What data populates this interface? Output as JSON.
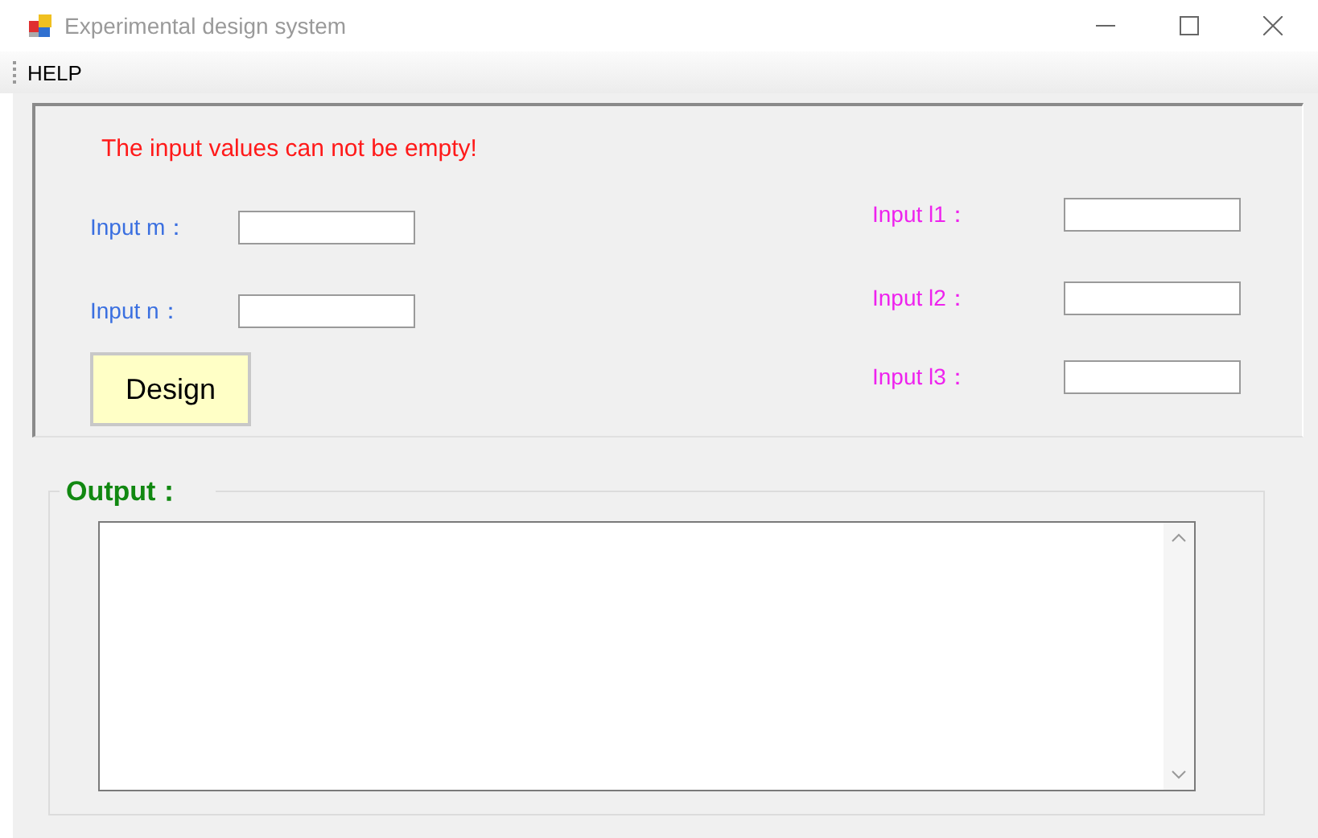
{
  "window": {
    "title": "Experimental design system"
  },
  "menu": [
    {
      "label": "HELP"
    }
  ],
  "error_message": "The input values can not be empty!",
  "left_inputs": [
    {
      "label": "Input m："
    },
    {
      "label": "Input n："
    }
  ],
  "right_inputs": [
    {
      "label": "Input l1："
    },
    {
      "label": "Input l2："
    },
    {
      "label": "Input l3："
    }
  ],
  "design_button": "Design",
  "output": {
    "label": "Output："
  }
}
